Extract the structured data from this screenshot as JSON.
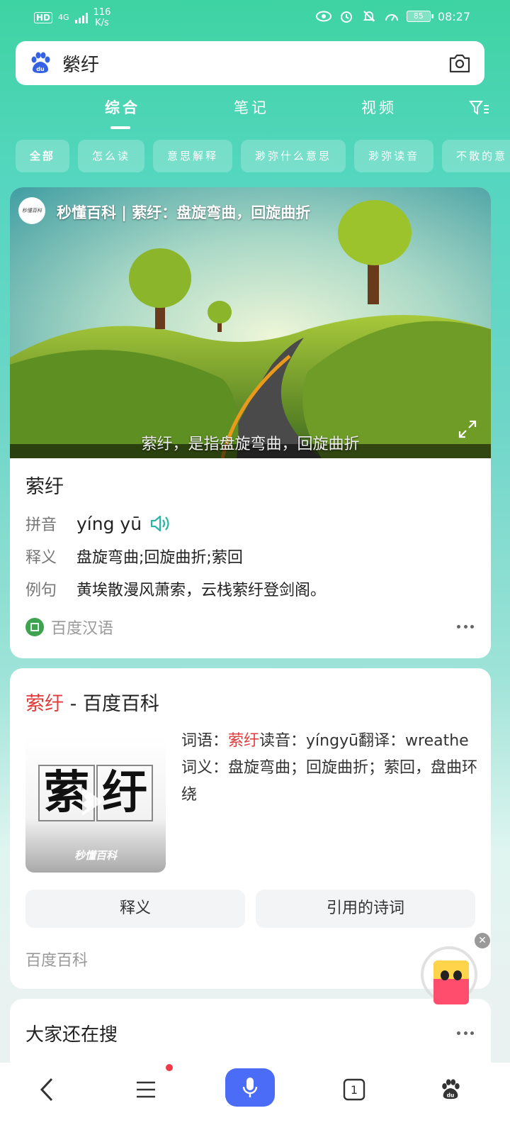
{
  "status_bar": {
    "network_type": "HD",
    "signal": "4G",
    "speed_value": "116",
    "speed_unit": "K/s",
    "battery": "85",
    "time": "08:27"
  },
  "search": {
    "query": "縈纡"
  },
  "tabs": [
    {
      "label": "综合",
      "active": true
    },
    {
      "label": "笔记",
      "active": false
    },
    {
      "label": "视频",
      "active": false
    }
  ],
  "chips": [
    "全部",
    "怎么读",
    "意思解释",
    "渺弥什么意思",
    "渺弥读音",
    "不散的意"
  ],
  "dict_card": {
    "video_logo": "秒懂百科",
    "video_title": "秒懂百科 | 萦纡：盘旋弯曲，回旋曲折",
    "video_subtitle": "萦纡，是指盘旋弯曲，回旋曲折",
    "word": "萦纡",
    "pinyin_label": "拼音",
    "pinyin_value": "yíng yū",
    "meaning_label": "释义",
    "meaning_value": "盘旋弯曲;回旋曲折;萦回",
    "example_label": "例句",
    "example_value": "黄埃散漫风萧索，云栈萦纡登剑阁。",
    "source": "百度汉语"
  },
  "baike_card": {
    "title_highlight": "萦纡",
    "title_rest": " - 百度百科",
    "thumb_chars": [
      "萦",
      "纡"
    ],
    "thumb_brand": "秒懂百科",
    "desc_label1": "词语：",
    "desc_word": "萦纡",
    "desc_rest": "读音：yíngyū翻译：wreathe 词义：盘旋弯曲；回旋曲折；萦回，盘曲环绕",
    "btn_meaning": "释义",
    "btn_poems": "引用的诗词",
    "source": "百度百科"
  },
  "related_card": {
    "title": "大家还在搜"
  },
  "bottom_nav": {
    "tab_count": "1"
  }
}
